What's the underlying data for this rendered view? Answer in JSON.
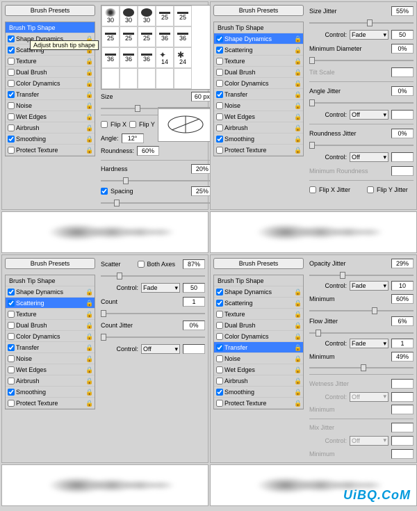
{
  "common": {
    "brush_presets": "Brush Presets",
    "brush_tip_shape": "Brush Tip Shape",
    "options": [
      "Shape Dynamics",
      "Scattering",
      "Texture",
      "Dual Brush",
      "Color Dynamics",
      "Transfer",
      "Noise",
      "Wet Edges",
      "Airbrush",
      "Smoothing",
      "Protect Texture"
    ],
    "tooltip": "Adjust brush tip shape",
    "watermark": "UiBQ.CoM"
  },
  "p1": {
    "selected": "Brush Tip Shape",
    "checks": [
      true,
      true,
      false,
      false,
      false,
      true,
      false,
      false,
      false,
      true,
      false
    ],
    "brush_sizes": [
      [
        "30",
        "30",
        "30",
        "25",
        "25"
      ],
      [
        "25",
        "25",
        "25",
        "36",
        "36"
      ],
      [
        "36",
        "36",
        "36",
        "14",
        "24"
      ],
      [
        "",
        "",
        "",
        "",
        ""
      ]
    ],
    "size_label": "Size",
    "size_val": "60 px",
    "flipx": "Flip X",
    "flipy": "Flip Y",
    "angle_label": "Angle:",
    "angle_val": "12°",
    "round_label": "Roundness:",
    "round_val": "60%",
    "hard_label": "Hardness",
    "hard_val": "20%",
    "spacing_label": "Spacing",
    "spacing_val": "25%"
  },
  "p2": {
    "selected": "Shape Dynamics",
    "checks": [
      true,
      true,
      false,
      false,
      false,
      true,
      false,
      false,
      false,
      true,
      false
    ],
    "size_jitter": "Size Jitter",
    "size_jitter_val": "55%",
    "control": "Control:",
    "fade": "Fade",
    "ctrl_val": "50",
    "min_diam": "Minimum Diameter",
    "min_diam_val": "0%",
    "tilt": "Tilt Scale",
    "angle_jitter": "Angle Jitter",
    "angle_jitter_val": "0%",
    "off": "Off",
    "round_jitter": "Roundness Jitter",
    "round_jitter_val": "0%",
    "min_round": "Minimum Roundness",
    "flipxj": "Flip X Jitter",
    "flipyj": "Flip Y Jitter"
  },
  "p3": {
    "selected": "Scattering",
    "checks": [
      true,
      true,
      false,
      false,
      false,
      true,
      false,
      false,
      false,
      true,
      false
    ],
    "scatter": "Scatter",
    "both": "Both Axes",
    "scatter_val": "87%",
    "control": "Control:",
    "fade": "Fade",
    "ctrl_val": "50",
    "count": "Count",
    "count_val": "1",
    "count_jitter": "Count Jitter",
    "cj_val": "0%",
    "off": "Off"
  },
  "p4": {
    "selected": "Transfer",
    "checks": [
      true,
      true,
      false,
      false,
      false,
      true,
      false,
      false,
      false,
      true,
      false
    ],
    "opac": "Opacity Jitter",
    "opac_val": "29%",
    "control": "Control:",
    "fade": "Fade",
    "c1": "10",
    "min": "Minimum",
    "min1": "60%",
    "flow": "Flow Jitter",
    "flow_val": "6%",
    "c2": "1",
    "min2": "49%",
    "wet": "Wetness Jitter",
    "off": "Off",
    "mix": "Mix Jitter"
  }
}
